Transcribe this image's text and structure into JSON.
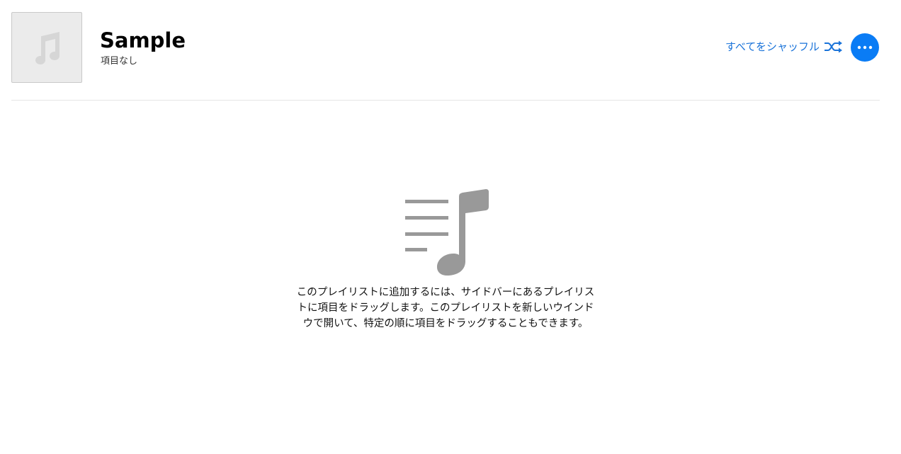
{
  "header": {
    "title": "Sample",
    "subtitle": "項目なし",
    "shuffle_label": "すべてをシャッフル",
    "artwork_icon": "music-note-icon",
    "shuffle_icon": "shuffle-icon",
    "more_icon": "ellipsis-icon"
  },
  "empty_state": {
    "icon": "playlist-music-icon",
    "message": "このプレイリストに追加するには、サイドバーにあるプレイリストに項目をドラッグします。このプレイリストを新しいウインドウで開いて、特定の順に項目をドラッグすることもできます。"
  },
  "colors": {
    "accent": "#0a7cf5",
    "link": "#1a73d9",
    "icon_gray": "#999999",
    "artwork_bg": "#ebebeb"
  }
}
